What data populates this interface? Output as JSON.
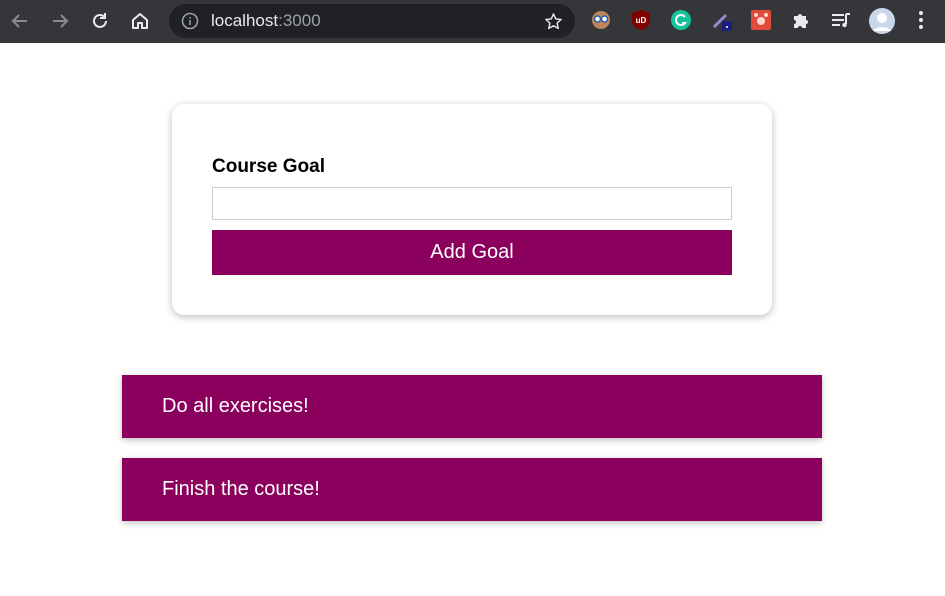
{
  "browser": {
    "url_host": "localhost",
    "url_port": ":3000",
    "icons": {
      "back": "arrow-left-icon",
      "forward": "arrow-right-icon",
      "reload": "reload-icon",
      "home": "home-icon",
      "info": "info-icon",
      "bookmark": "star-icon",
      "extensions": "puzzle-icon",
      "media": "playlist-icon",
      "menu": "kebab-menu-icon"
    }
  },
  "form": {
    "label": "Course Goal",
    "input_value": "",
    "button_label": "Add Goal"
  },
  "goals": [
    {
      "text": "Do all exercises!"
    },
    {
      "text": "Finish the course!"
    }
  ],
  "colors": {
    "accent": "#8b005d",
    "chrome_bg": "#35363a",
    "omnibox_bg": "#202124"
  }
}
